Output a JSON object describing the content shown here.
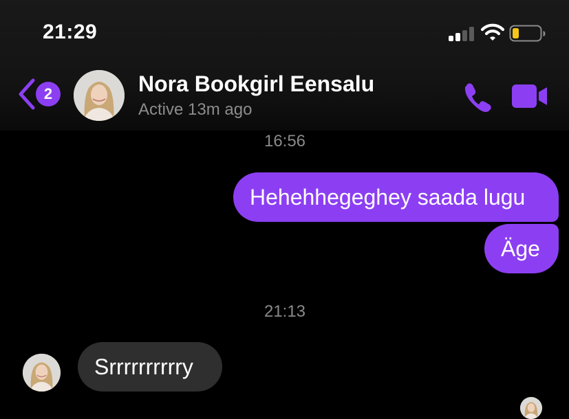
{
  "status_bar": {
    "time": "21:29",
    "signal_icon": "cellular-signal-icon",
    "wifi_icon": "wifi-icon",
    "battery_icon": "battery-low-icon",
    "battery_color": "#f5c518"
  },
  "header": {
    "back_icon": "chevron-left-icon",
    "unread_count": "2",
    "contact_name": "Nora Bookgirl Eensalu",
    "active_status": "Active 13m ago",
    "call_icon": "phone-icon",
    "video_icon": "video-camera-icon"
  },
  "theme": {
    "accent": "#8c3ff2",
    "incoming_bubble": "#2f2f2f",
    "background": "#000000",
    "muted_text": "#8a8a8a"
  },
  "messages": [
    {
      "type": "timestamp",
      "text": "16:56"
    },
    {
      "type": "outgoing",
      "text": "Hehehhegeghey saada lugu"
    },
    {
      "type": "outgoing",
      "text": "Äge"
    },
    {
      "type": "timestamp",
      "text": "21:13"
    },
    {
      "type": "incoming",
      "text": "Srrrrrrrrrry"
    }
  ]
}
